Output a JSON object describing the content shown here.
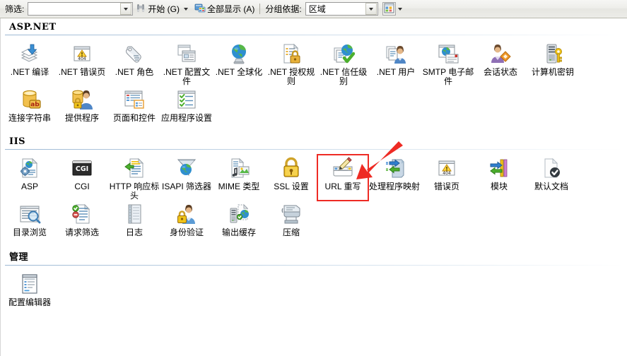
{
  "toolbar": {
    "filter_label": "筛选:",
    "filter_value": "",
    "filter_placeholder": "",
    "go_button": "开始 (G)",
    "show_all_button": "全部显示 (A)",
    "group_by_label": "分组依据:",
    "group_by_value": "区域",
    "view_icon": "view-tiles-icon",
    "binoculars_icon": "binoculars-icon",
    "showall_icon": "show-all-icon"
  },
  "groups": [
    {
      "title": "ASP.NET",
      "items": [
        {
          "label": ".NET 编译",
          "icon": "net-compilation-icon",
          "highlighted": false
        },
        {
          "label": ".NET 错误页",
          "icon": "net-error-pages-icon",
          "highlighted": false
        },
        {
          "label": ".NET 角色",
          "icon": "net-roles-icon",
          "highlighted": false
        },
        {
          "label": ".NET 配置文件",
          "icon": "net-profile-icon",
          "highlighted": false
        },
        {
          "label": ".NET 全球化",
          "icon": "net-globalization-icon",
          "highlighted": false
        },
        {
          "label": ".NET 授权规则",
          "icon": "net-authorization-rules-icon",
          "highlighted": false
        },
        {
          "label": ".NET 信任级别",
          "icon": "net-trust-levels-icon",
          "highlighted": false
        },
        {
          "label": ".NET 用户",
          "icon": "net-users-icon",
          "highlighted": false
        },
        {
          "label": "SMTP 电子邮件",
          "icon": "smtp-email-icon",
          "highlighted": false
        },
        {
          "label": "会话状态",
          "icon": "session-state-icon",
          "highlighted": false
        },
        {
          "label": "计算机密钥",
          "icon": "machine-key-icon",
          "highlighted": false
        },
        {
          "label": "连接字符串",
          "icon": "connection-strings-icon",
          "highlighted": false
        },
        {
          "label": "提供程序",
          "icon": "providers-icon",
          "highlighted": false
        },
        {
          "label": "页面和控件",
          "icon": "pages-and-controls-icon",
          "highlighted": false
        },
        {
          "label": "应用程序设置",
          "icon": "application-settings-icon",
          "highlighted": false
        }
      ]
    },
    {
      "title": "IIS",
      "items": [
        {
          "label": "ASP",
          "icon": "asp-icon",
          "highlighted": false
        },
        {
          "label": "CGI",
          "icon": "cgi-icon",
          "highlighted": false
        },
        {
          "label": "HTTP 响应标头",
          "icon": "http-response-headers-icon",
          "highlighted": false
        },
        {
          "label": "ISAPI 筛选器",
          "icon": "isapi-filters-icon",
          "highlighted": false
        },
        {
          "label": "MIME 类型",
          "icon": "mime-types-icon",
          "highlighted": false
        },
        {
          "label": "SSL 设置",
          "icon": "ssl-settings-icon",
          "highlighted": false
        },
        {
          "label": "URL 重写",
          "icon": "url-rewrite-icon",
          "highlighted": true
        },
        {
          "label": "处理程序映射",
          "icon": "handler-mappings-icon",
          "highlighted": false
        },
        {
          "label": "错误页",
          "icon": "error-pages-icon",
          "highlighted": false
        },
        {
          "label": "模块",
          "icon": "modules-icon",
          "highlighted": false
        },
        {
          "label": "默认文档",
          "icon": "default-document-icon",
          "highlighted": false
        },
        {
          "label": "目录浏览",
          "icon": "directory-browsing-icon",
          "highlighted": false
        },
        {
          "label": "请求筛选",
          "icon": "request-filtering-icon",
          "highlighted": false
        },
        {
          "label": "日志",
          "icon": "logging-icon",
          "highlighted": false
        },
        {
          "label": "身份验证",
          "icon": "authentication-icon",
          "highlighted": false
        },
        {
          "label": "输出缓存",
          "icon": "output-caching-icon",
          "highlighted": false
        },
        {
          "label": "压缩",
          "icon": "compression-icon",
          "highlighted": false
        }
      ]
    },
    {
      "title": "管理",
      "items": [
        {
          "label": "配置编辑器",
          "icon": "configuration-editor-icon",
          "highlighted": false
        }
      ]
    }
  ],
  "annotation": {
    "color": "#ee2b24",
    "target": "URL 重写"
  }
}
